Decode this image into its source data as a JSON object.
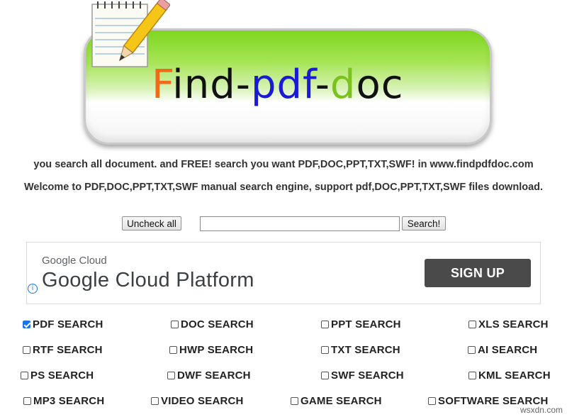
{
  "logo": {
    "letters": [
      {
        "char": "F",
        "color": "#f06a1a"
      },
      {
        "char": "ind-",
        "color": "#111111"
      },
      {
        "char": "pdf",
        "color": "#1a1ad6"
      },
      {
        "char": "-",
        "color": "#111111"
      },
      {
        "char": "d",
        "color": "#7cc21d"
      },
      {
        "char": "oc",
        "color": "#111111"
      }
    ]
  },
  "taglines": [
    "you search all document. and FREE! search you want PDF,DOC,PPT,TXT,SWF! in www.findpdfdoc.com",
    "Welcome to PDF,DOC,PPT,TXT,SWF manual search engine, support pdf,DOC,PPT,TXT,SWF files download."
  ],
  "search": {
    "uncheck_label": "Uncheck all",
    "input_value": "",
    "search_label": "Search!"
  },
  "ad": {
    "brand": "Google Cloud",
    "title": "Google Cloud Platform",
    "cta": "SIGN UP",
    "info_icon": "info-icon"
  },
  "options": [
    {
      "label": "PDF SEARCH",
      "checked": true
    },
    {
      "label": "DOC SEARCH",
      "checked": false
    },
    {
      "label": "PPT SEARCH",
      "checked": false
    },
    {
      "label": "XLS SEARCH",
      "checked": false
    },
    {
      "label": "RTF SEARCH",
      "checked": false
    },
    {
      "label": "HWP SEARCH",
      "checked": false
    },
    {
      "label": "TXT SEARCH",
      "checked": false
    },
    {
      "label": "AI SEARCH",
      "checked": false
    },
    {
      "label": "PS SEARCH",
      "checked": false
    },
    {
      "label": "DWF SEARCH",
      "checked": false
    },
    {
      "label": "SWF SEARCH",
      "checked": false
    },
    {
      "label": "KML SEARCH",
      "checked": false
    },
    {
      "label": "MP3 SEARCH",
      "checked": false
    },
    {
      "label": "VIDEO SEARCH",
      "checked": false
    },
    {
      "label": "GAME SEARCH",
      "checked": false
    },
    {
      "label": "SOFTWARE SEARCH",
      "checked": false
    }
  ],
  "watermark": "wsxdn.com"
}
